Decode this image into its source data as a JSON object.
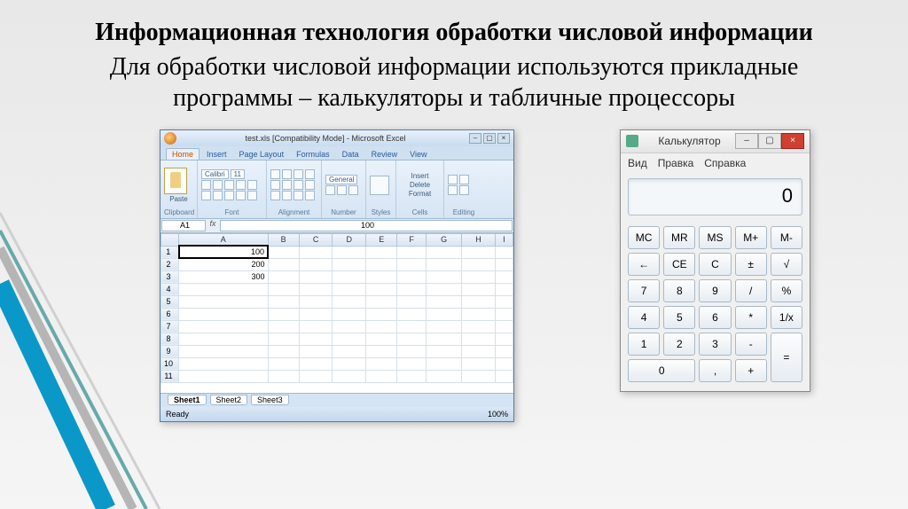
{
  "heading": "Информационная технология обработки числовой информации",
  "subtitle": "Для обработки числовой информации используются прикладные программы – калькуляторы и табличные процессоры",
  "excel": {
    "title": "test.xls [Compatibility Mode] - Microsoft Excel",
    "tabs": [
      "Home",
      "Insert",
      "Page Layout",
      "Formulas",
      "Data",
      "Review",
      "View"
    ],
    "ribbon_groups": {
      "clipboard": "Clipboard",
      "paste": "Paste",
      "font_name": "Calibri",
      "font_size": "11",
      "font": "Font",
      "alignment": "Alignment",
      "number_format": "General",
      "number": "Number",
      "styles": "Styles",
      "insert": "Insert",
      "delete": "Delete",
      "format": "Format",
      "cells": "Cells",
      "editing": "Editing"
    },
    "name_box": "A1",
    "formula": "100",
    "columns": [
      "",
      "A",
      "B",
      "C",
      "D",
      "E",
      "F",
      "G",
      "H",
      "I"
    ],
    "rows": [
      {
        "n": "1",
        "v": "100"
      },
      {
        "n": "2",
        "v": "200"
      },
      {
        "n": "3",
        "v": "300"
      },
      {
        "n": "4",
        "v": ""
      },
      {
        "n": "5",
        "v": ""
      },
      {
        "n": "6",
        "v": ""
      },
      {
        "n": "7",
        "v": ""
      },
      {
        "n": "8",
        "v": ""
      },
      {
        "n": "9",
        "v": ""
      },
      {
        "n": "10",
        "v": ""
      },
      {
        "n": "11",
        "v": ""
      }
    ],
    "sheets": [
      "Sheet1",
      "Sheet2",
      "Sheet3"
    ],
    "status_left": "Ready",
    "zoom": "100%"
  },
  "calc": {
    "title": "Калькулятор",
    "menu": [
      "Вид",
      "Правка",
      "Справка"
    ],
    "display": "0",
    "buttons": [
      "MC",
      "MR",
      "MS",
      "M+",
      "M-",
      "←",
      "CE",
      "C",
      "±",
      "√",
      "7",
      "8",
      "9",
      "/",
      "%",
      "4",
      "5",
      "6",
      "*",
      "1/x",
      "1",
      "2",
      "3",
      "-",
      "=",
      "0",
      ",",
      "+"
    ]
  }
}
